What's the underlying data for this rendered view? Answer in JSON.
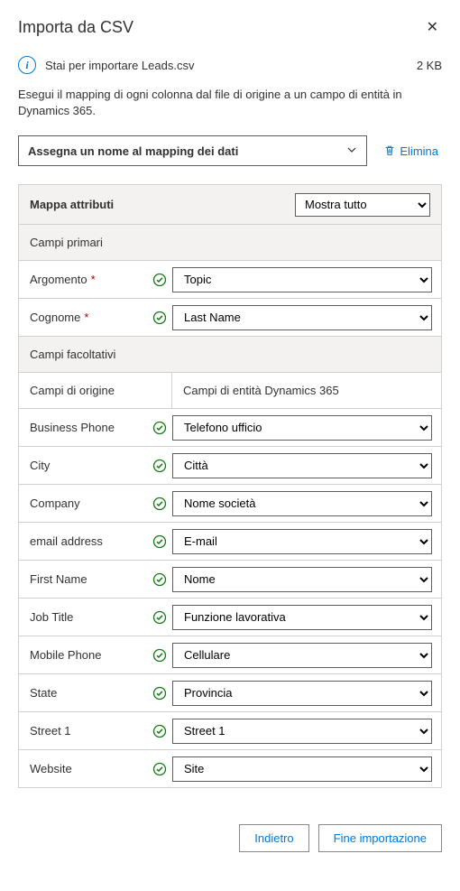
{
  "header": {
    "title": "Importa da CSV"
  },
  "info": {
    "text": "Stai per importare Leads.csv",
    "size": "2 KB"
  },
  "description": "Esegui il mapping di ogni colonna dal file di origine a un campo di entità in Dynamics 365.",
  "mapping": {
    "name_placeholder": "Assegna un nome al mapping dei dati",
    "delete_label": "Elimina"
  },
  "sections": {
    "map_attributes": "Mappa attributi",
    "filter_label": "Mostra tutto",
    "primary_fields": "Campi primari",
    "optional_fields": "Campi facoltativi",
    "source_col": "Campi di origine",
    "dest_col": "Campi di entità Dynamics 365"
  },
  "primary_rows": [
    {
      "src": "Argomento",
      "required": true,
      "dst": "Topic"
    },
    {
      "src": "Cognome",
      "required": true,
      "dst": "Last Name"
    }
  ],
  "optional_rows": [
    {
      "src": "Business Phone",
      "dst": "Telefono ufficio"
    },
    {
      "src": "City",
      "dst": "Città"
    },
    {
      "src": "Company",
      "dst": "Nome società"
    },
    {
      "src": "email address",
      "dst": "E-mail"
    },
    {
      "src": "First Name",
      "dst": "Nome"
    },
    {
      "src": "Job Title",
      "dst": "Funzione lavorativa"
    },
    {
      "src": "Mobile Phone",
      "dst": "Cellulare"
    },
    {
      "src": "State",
      "dst": "Provincia"
    },
    {
      "src": "Street 1",
      "dst": "Street 1"
    },
    {
      "src": "Website",
      "dst": "Site"
    }
  ],
  "footer": {
    "back": "Indietro",
    "finish": "Fine importazione"
  }
}
